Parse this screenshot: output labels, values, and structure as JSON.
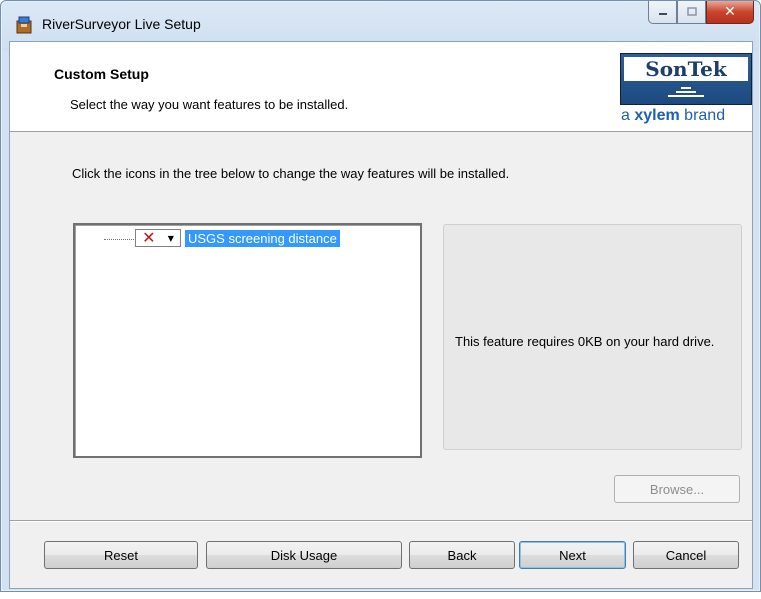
{
  "window": {
    "title": "RiverSurveyor Live Setup",
    "caption_buttons": [
      "minimize-icon",
      "maximize-icon",
      "close-icon"
    ]
  },
  "banner": {
    "title": "Custom Setup",
    "subtitle": "Select the way you want features to be installed.",
    "logo": {
      "brand": "SonTek",
      "tagline_prefix": "a ",
      "tagline_bold": "xylem",
      "tagline_suffix": " brand"
    }
  },
  "instructions": "Click the icons in the tree below to change the way features will be installed.",
  "tree": {
    "items": [
      {
        "label": "USGS screening distance",
        "state_icon": "x-icon",
        "selected": true
      }
    ]
  },
  "description": "This feature requires 0KB on your hard drive.",
  "buttons": {
    "browse": "Browse...",
    "reset": "Reset",
    "disk_usage": "Disk Usage",
    "back": "Back",
    "next": "Next",
    "cancel": "Cancel"
  },
  "colors": {
    "selection": "#3399ff",
    "not_installed_icon": "#c0181e",
    "brand_blue": "#1c4a80"
  }
}
